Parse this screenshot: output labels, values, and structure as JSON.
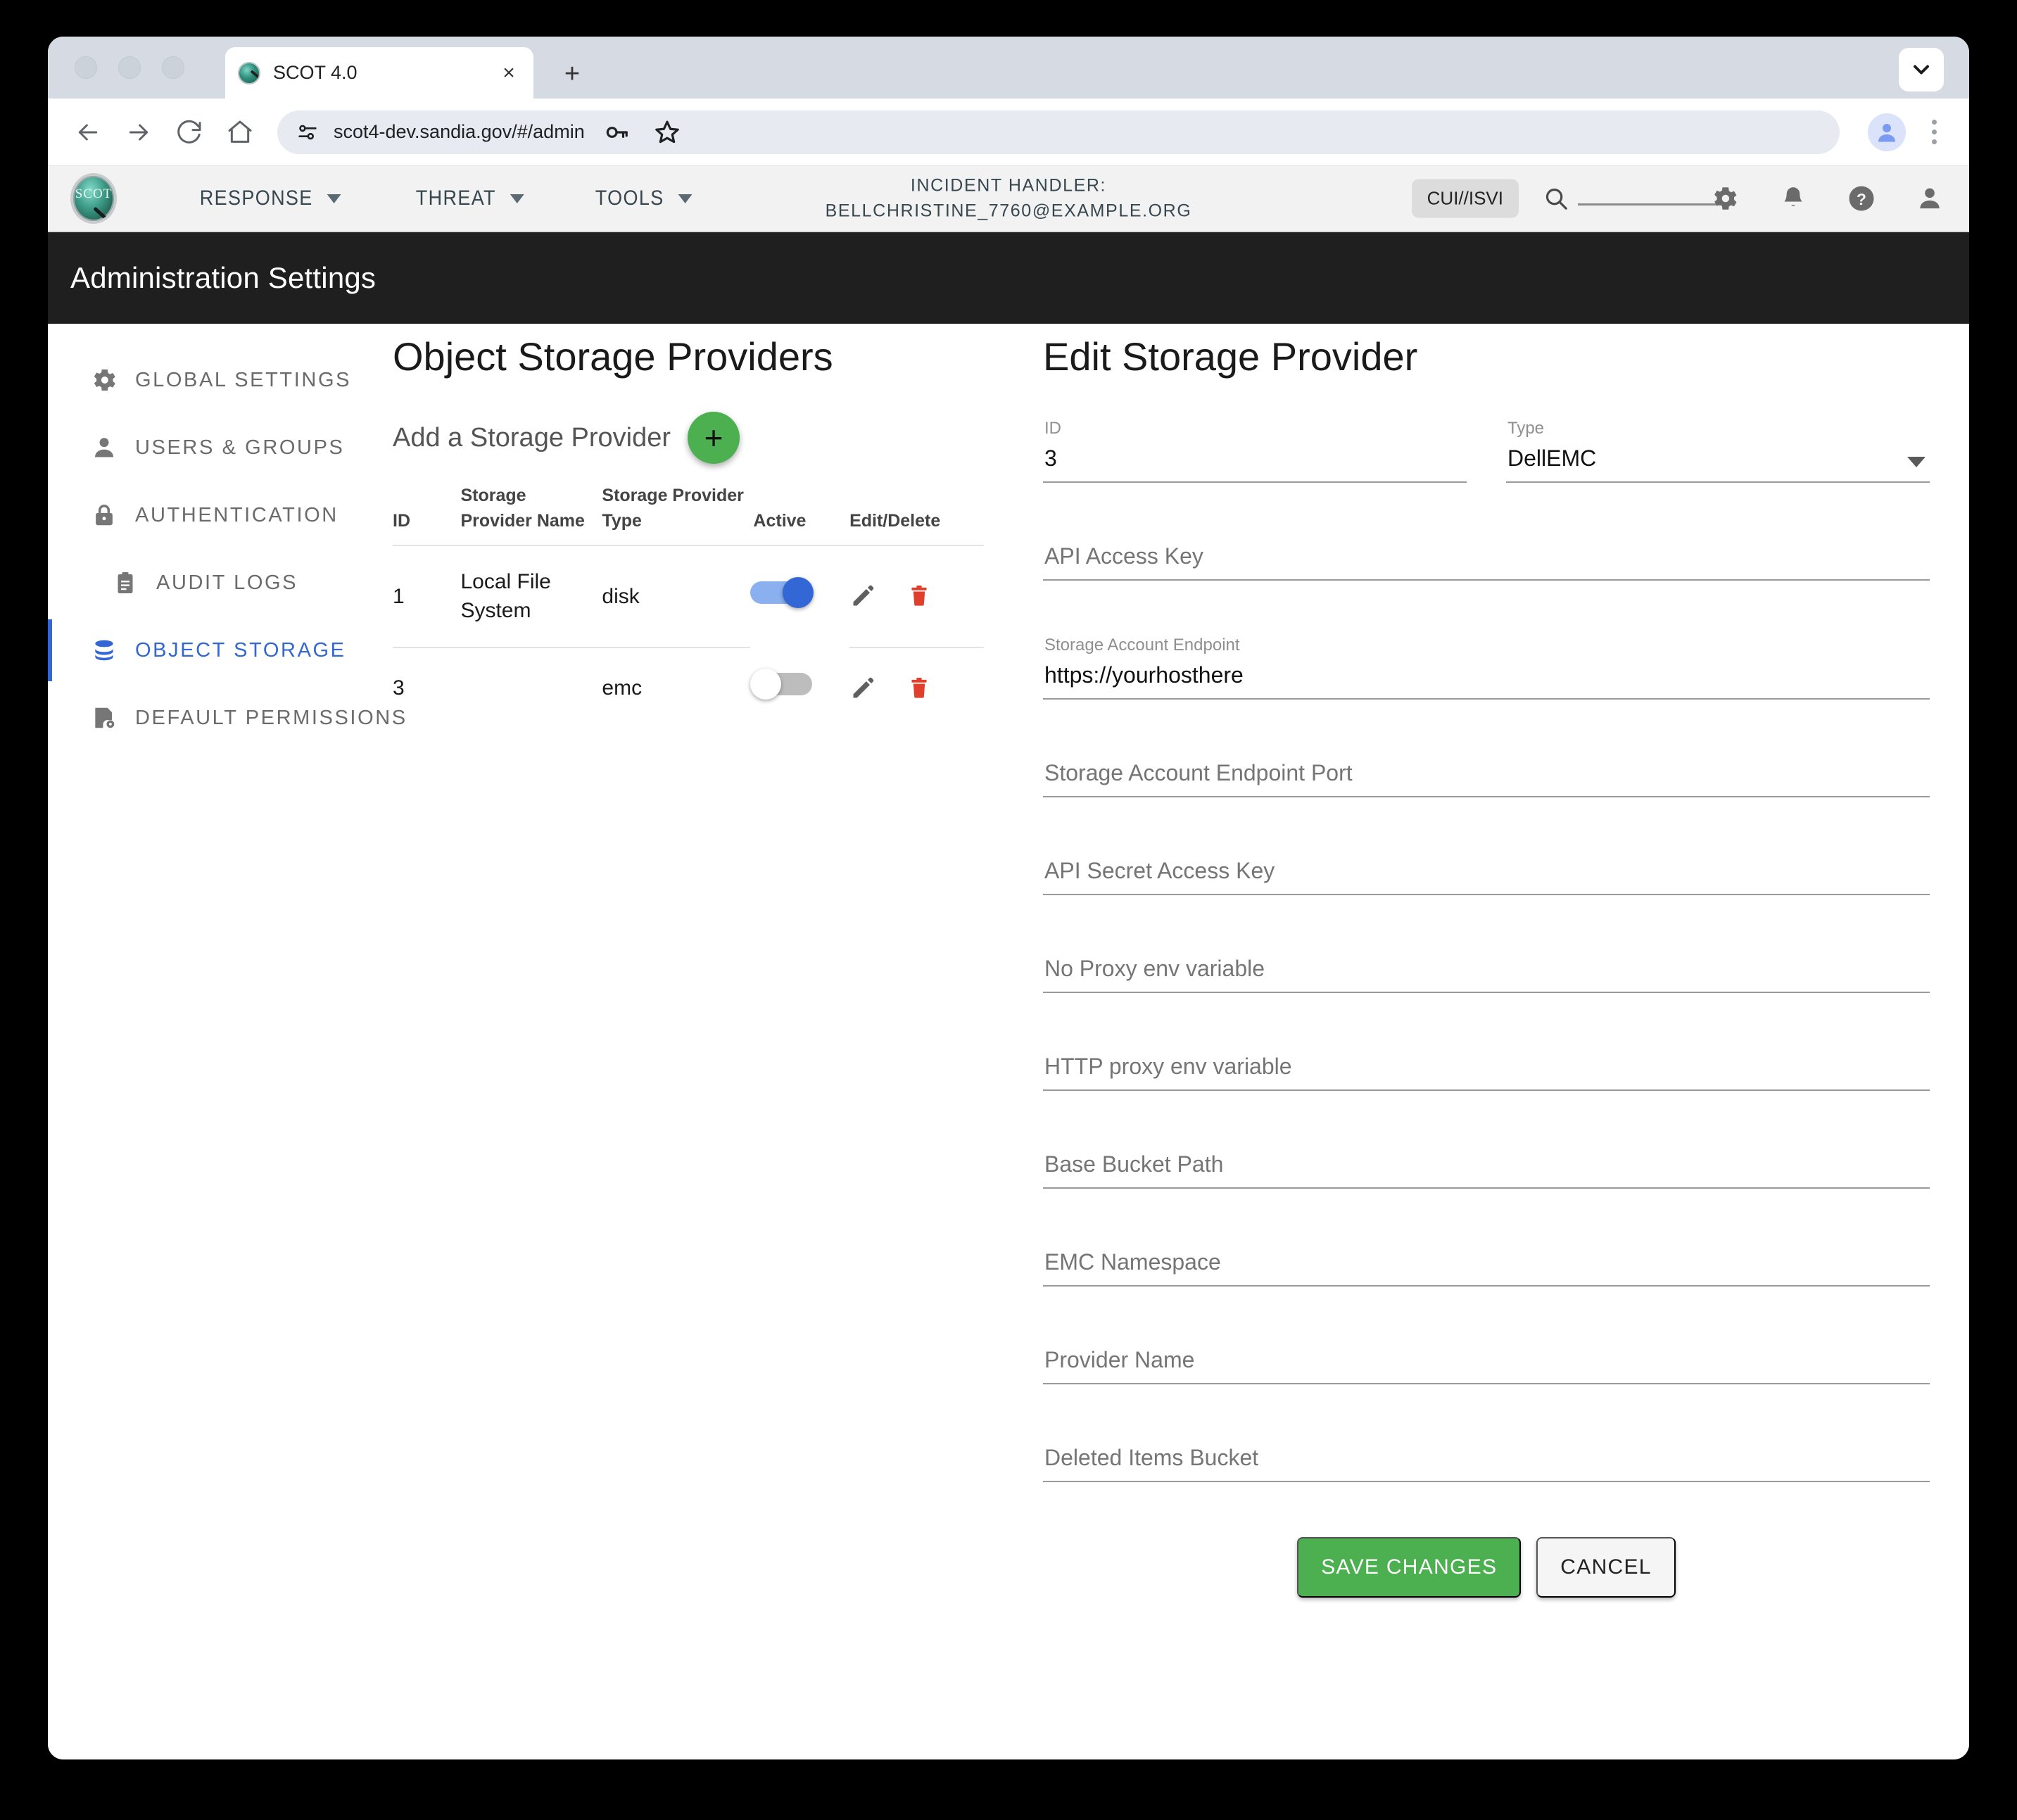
{
  "browser": {
    "tab_title": "SCOT 4.0",
    "url": "scot4-dev.sandia.gov/#/admin",
    "new_tab_label": "+",
    "close_tab_label": "×"
  },
  "app_header": {
    "nav": [
      {
        "label": "RESPONSE"
      },
      {
        "label": "THREAT"
      },
      {
        "label": "TOOLS"
      }
    ],
    "handler_line1": "INCIDENT HANDLER:",
    "handler_line2": "BELLCHRISTINE_7760@EXAMPLE.ORG",
    "cui_badge": "CUI//ISVI",
    "search_value": ""
  },
  "admin_band": {
    "title": "Administration Settings"
  },
  "sidebar": {
    "items": [
      {
        "label": "GLOBAL SETTINGS",
        "icon": "gear-icon",
        "active": false
      },
      {
        "label": "USERS & GROUPS",
        "icon": "person-icon",
        "active": false
      },
      {
        "label": "AUTHENTICATION",
        "icon": "lock-icon",
        "active": false
      },
      {
        "label": "AUDIT LOGS",
        "icon": "clipboard-icon",
        "active": false
      },
      {
        "label": "OBJECT STORAGE",
        "icon": "database-icon",
        "active": true
      },
      {
        "label": "DEFAULT PERMISSIONS",
        "icon": "permissions-icon",
        "active": false
      }
    ]
  },
  "providers_panel": {
    "title": "Object Storage Providers",
    "add_label": "Add a Storage Provider",
    "add_button": "+",
    "columns": [
      "ID",
      "Storage Provider Name",
      "Storage Provider Type",
      "Active",
      "Edit/Delete"
    ],
    "rows": [
      {
        "id": "1",
        "name": "Local File System",
        "type": "disk",
        "active": true
      },
      {
        "id": "3",
        "name": "",
        "type": "emc",
        "active": false
      }
    ]
  },
  "edit_panel": {
    "title": "Edit Storage Provider",
    "fields": [
      {
        "label": "ID",
        "value": "3",
        "placeholder": "",
        "kind": "text"
      },
      {
        "label": "Type",
        "value": "DellEMC",
        "placeholder": "",
        "kind": "select"
      },
      {
        "label": "API Access Key",
        "value": "",
        "placeholder": "API Access Key",
        "kind": "text"
      },
      {
        "label": "Storage Account Endpoint",
        "value": "https://yourhosthere",
        "placeholder": "",
        "kind": "text"
      },
      {
        "label": "Storage Account Endpoint Port",
        "value": "",
        "placeholder": "Storage Account Endpoint Port",
        "kind": "text"
      },
      {
        "label": "API Secret Access Key",
        "value": "",
        "placeholder": "API Secret Access Key",
        "kind": "text"
      },
      {
        "label": "No Proxy env variable",
        "value": "",
        "placeholder": "No Proxy env variable",
        "kind": "text"
      },
      {
        "label": "HTTP proxy env variable",
        "value": "",
        "placeholder": "HTTP proxy env variable",
        "kind": "text"
      },
      {
        "label": "Base Bucket Path",
        "value": "",
        "placeholder": "Base Bucket Path",
        "kind": "text"
      },
      {
        "label": "EMC Namespace",
        "value": "",
        "placeholder": "EMC Namespace",
        "kind": "text"
      },
      {
        "label": "Provider Name",
        "value": "",
        "placeholder": "Provider Name",
        "kind": "text"
      },
      {
        "label": "Deleted Items Bucket",
        "value": "",
        "placeholder": "Deleted Items Bucket",
        "kind": "text"
      }
    ],
    "save_label": "SAVE CHANGES",
    "cancel_label": "CANCEL"
  },
  "colors": {
    "accent_blue": "#3367d6",
    "green": "#4CAF50",
    "delete_red": "#e0402b",
    "band_black": "#1f1f1f"
  }
}
